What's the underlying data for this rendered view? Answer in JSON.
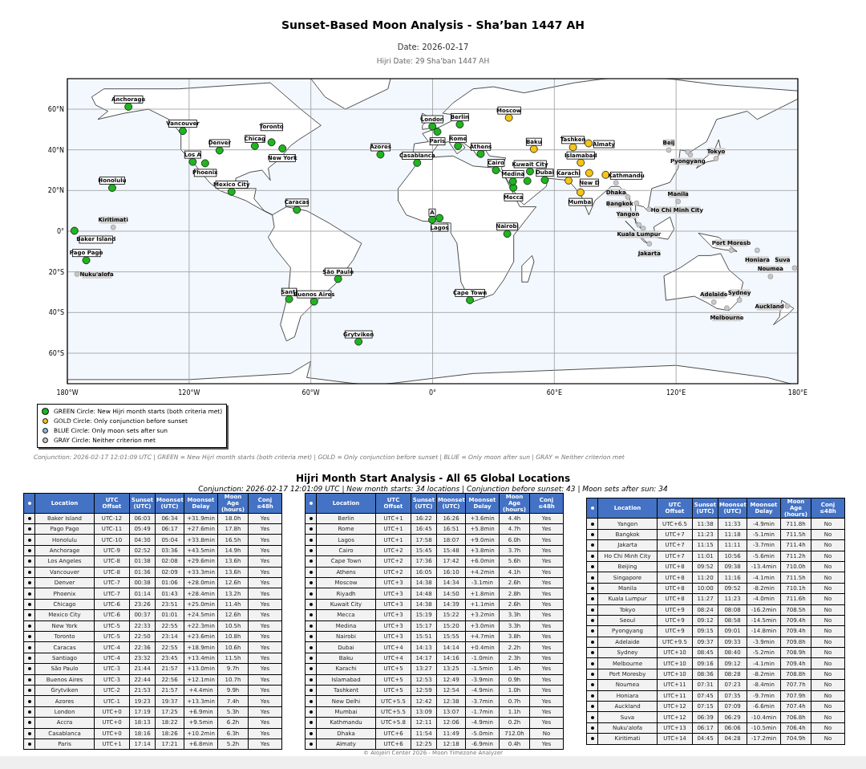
{
  "title": "Sunset-Based Moon Analysis - Sha’ban 1447 AH",
  "date": "Date: 2026-02-17",
  "hijri_date": "Hijri Date: 29 Sha'ban 1447 AH",
  "map": {
    "chart_data": {
      "type": "scatter",
      "grid": true,
      "xlim": [
        -180,
        180
      ],
      "ylim": [
        -75,
        75
      ],
      "xticks": [
        {
          "value": -180,
          "label": "180°W"
        },
        {
          "value": -120,
          "label": "120°W"
        },
        {
          "value": -60,
          "label": "60°W"
        },
        {
          "value": 0,
          "label": "0°"
        },
        {
          "value": 60,
          "label": "60°E"
        },
        {
          "value": 120,
          "label": "120°E"
        },
        {
          "value": 180,
          "label": "180°E"
        }
      ],
      "yticks": [
        {
          "value": 60,
          "label": "60°N"
        },
        {
          "value": 40,
          "label": "40°N"
        },
        {
          "value": 20,
          "label": "20°N"
        },
        {
          "value": 0,
          "label": "0°"
        },
        {
          "value": -20,
          "label": "20°S"
        },
        {
          "value": -40,
          "label": "40°S"
        },
        {
          "value": -60,
          "label": "60°S"
        }
      ],
      "series": [
        {
          "name": "GREEN Circle: New Hijri month starts (both criteria met)",
          "color": "#1fb51f",
          "x": [
            -176.5,
            -170.7,
            -157.9,
            -149.9,
            -118.2,
            -123.1,
            -105,
            -112.1,
            -87.6,
            -99.1,
            -74,
            -79.4,
            -66.9,
            -70.7,
            -46.6,
            -58.4,
            -36.5,
            -25.7,
            -0.1,
            -0.2,
            -7.6,
            2.35,
            13.4,
            12.5,
            3.4,
            31.2,
            18.4,
            23.7,
            46.7,
            48,
            39.8,
            39.6,
            36.8,
            55.3
          ],
          "values": [
            0.2,
            -14.3,
            21.3,
            61.2,
            34.1,
            49.3,
            39.7,
            33.4,
            41.9,
            19.4,
            40.7,
            43.7,
            10.5,
            -33.4,
            -23.5,
            -34.6,
            -54.3,
            37.7,
            51.5,
            5.6,
            33.6,
            48.9,
            52.5,
            41.9,
            6.5,
            30,
            -33.9,
            38,
            24.7,
            29.4,
            21.4,
            24.5,
            -1.3,
            25.2
          ]
        },
        {
          "name": "GOLD Circle: Only conjunction before sunset",
          "color": "#f5c518",
          "x": [
            37.6,
            49.9,
            67,
            73,
            69.2,
            77.2,
            72.9,
            85.3,
            76.9
          ],
          "values": [
            55.8,
            40.4,
            24.9,
            33.7,
            41.3,
            28.6,
            19.1,
            27.7,
            43.2
          ]
        },
        {
          "name": "BLUE Circle: Only moon sets after sun",
          "color": "#8fbbd9"
        },
        {
          "name": "GRAY Circle: Neither criterion met",
          "color": "#c8c8c8",
          "x": [
            90.4,
            96.2,
            100.5,
            106.8,
            106.7,
            116.4,
            103.8,
            121,
            101.7,
            139.7,
            127,
            125.8,
            138.6,
            151.2,
            145,
            147.2,
            166.5,
            160,
            174.8,
            178.4,
            -175.2,
            -157.4
          ],
          "values": [
            23.8,
            16.8,
            13.8,
            -6.2,
            10.8,
            39.9,
            1.4,
            14.6,
            3.1,
            35.7,
            37.6,
            39,
            -34.9,
            -33.9,
            -37.8,
            -9.4,
            -22.3,
            -9.4,
            -36.8,
            -18.1,
            -21.1,
            1.9
          ]
        }
      ],
      "annotations": [
        {
          "text": "Baker Island",
          "x": -176.5,
          "y": 0.2
        },
        {
          "text": "Pago Pago",
          "x": -170.7,
          "y": -14.3
        },
        {
          "text": "Honolulu",
          "x": -157.9,
          "y": 21.3
        },
        {
          "text": "Anchorage",
          "x": -149.9,
          "y": 61.2
        },
        {
          "text": "Los A",
          "x": -118.2,
          "y": 34.1
        },
        {
          "text": "Vancouver",
          "x": -123.1,
          "y": 49.3
        },
        {
          "text": "Denver",
          "x": -105,
          "y": 39.7
        },
        {
          "text": "Phoenix",
          "x": -112.1,
          "y": 33.4
        },
        {
          "text": "Chicag",
          "x": -87.6,
          "y": 41.9
        },
        {
          "text": "Mexico City",
          "x": -99.1,
          "y": 19.4
        },
        {
          "text": "New York",
          "x": -74,
          "y": 40.7
        },
        {
          "text": "Toronto",
          "x": -79.4,
          "y": 43.7
        },
        {
          "text": "Caracas",
          "x": -66.9,
          "y": 10.5
        },
        {
          "text": "Santi",
          "x": -70.7,
          "y": -33.4
        },
        {
          "text": "São Paulo",
          "x": -46.6,
          "y": -23.5
        },
        {
          "text": "Buenos Aires",
          "x": -58.4,
          "y": -34.6
        },
        {
          "text": "Grytviken",
          "x": -36.5,
          "y": -54.3
        },
        {
          "text": "Azores",
          "x": -25.7,
          "y": 37.7
        },
        {
          "text": "London",
          "x": -0.1,
          "y": 51.5
        },
        {
          "text": "A",
          "x": -0.2,
          "y": 5.6
        },
        {
          "text": "Casablanca",
          "x": -7.6,
          "y": 33.6
        },
        {
          "text": "Paris",
          "x": 2.35,
          "y": 48.9
        },
        {
          "text": "Berlin",
          "x": 13.4,
          "y": 52.5
        },
        {
          "text": "Rome",
          "x": 12.5,
          "y": 41.9
        },
        {
          "text": "Lagos",
          "x": 3.4,
          "y": 6.5
        },
        {
          "text": "Cairo",
          "x": 31.2,
          "y": 30
        },
        {
          "text": "Cape Town",
          "x": 18.4,
          "y": -33.9
        },
        {
          "text": "Athens",
          "x": 23.7,
          "y": 38
        },
        {
          "text": "Kuwait City",
          "x": 48,
          "y": 29.4
        },
        {
          "text": "Mecca",
          "x": 39.8,
          "y": 21.4
        },
        {
          "text": "Medina",
          "x": 39.6,
          "y": 24.5
        },
        {
          "text": "Nairobi",
          "x": 36.8,
          "y": -1.3
        },
        {
          "text": "Dubai",
          "x": 55.3,
          "y": 25.2
        },
        {
          "text": "Moscow",
          "x": 37.6,
          "y": 55.8
        },
        {
          "text": "Baku",
          "x": 49.9,
          "y": 40.4
        },
        {
          "text": "Karachi",
          "x": 67,
          "y": 24.9
        },
        {
          "text": "Islamabad",
          "x": 73,
          "y": 33.7
        },
        {
          "text": "Tashken",
          "x": 69.2,
          "y": 41.3
        },
        {
          "text": "Almaty",
          "x": 76.9,
          "y": 43.2
        },
        {
          "text": "New D",
          "x": 77.2,
          "y": 28.6
        },
        {
          "text": "Kathmandu",
          "x": 85.3,
          "y": 27.7
        },
        {
          "text": "Mumbai",
          "x": 72.9,
          "y": 19.1
        },
        {
          "text": "Dhaka",
          "x": 90.4,
          "y": 23.8
        },
        {
          "text": "Yangon",
          "x": 96.2,
          "y": 16.8
        },
        {
          "text": "Bangkok",
          "x": 100.5,
          "y": 13.8
        },
        {
          "text": "Ho Chi Minh City",
          "x": 106.7,
          "y": 10.8
        },
        {
          "text": "Beij",
          "x": 116.4,
          "y": 39.9
        },
        {
          "text": "Pyongyang",
          "x": 125.8,
          "y": 39
        },
        {
          "text": "Tokyo",
          "x": 139.7,
          "y": 35.7
        },
        {
          "text": "Manila",
          "x": 121,
          "y": 14.6
        },
        {
          "text": "Kuala Lumpur",
          "x": 101.7,
          "y": 3.1
        },
        {
          "text": "Jakarta",
          "x": 106.8,
          "y": -6.2
        },
        {
          "text": "Port Moresb",
          "x": 147.2,
          "y": -9.4
        },
        {
          "text": "Honiara",
          "x": 160,
          "y": -9.4
        },
        {
          "text": "Noumea",
          "x": 166.5,
          "y": -22.3
        },
        {
          "text": "Suva",
          "x": 178.4,
          "y": -18.1
        },
        {
          "text": "Adelaide",
          "x": 138.6,
          "y": -34.9
        },
        {
          "text": "Sydney",
          "x": 151.2,
          "y": -33.9
        },
        {
          "text": "Melbourne",
          "x": 145,
          "y": -37.8
        },
        {
          "text": "Auckland",
          "x": 174.8,
          "y": -36.8
        },
        {
          "text": "Nuku'alofa",
          "x": -175.2,
          "y": -21.1
        },
        {
          "text": "Kiritimati",
          "x": -157.4,
          "y": 1.9
        }
      ]
    }
  },
  "caption": "Conjunction: 2026-02-17 12:01:09 UTC | GREEN = New Hijri month starts (both criteria met) | GOLD = Only conjunction before sunset | BLUE = Only moon after sun | GRAY = Neither criterion met",
  "table_title": "Hijri Month Start Analysis - All 65 Global Locations",
  "table_subtitle": "Conjunction: 2026-02-17 12:01:09 UTC | New month starts: 34 locations | Conjunction before sunset: 43 | Moon sets after sun: 34",
  "tables": [
    {
      "columns": [
        "Location",
        "UTC Offset",
        "Sunset (UTC)",
        "Moonset (UTC)",
        "Moonset Delay",
        "Moon Age (hours)",
        "Conj ≤48h"
      ],
      "rows": [
        [
          "Baker Island",
          "UTC-12",
          "06:03",
          "06:34",
          "+31.9min",
          "18.0h",
          "Yes"
        ],
        [
          "Pago Pago",
          "UTC-11",
          "05:49",
          "06:17",
          "+27.6min",
          "17.8h",
          "Yes"
        ],
        [
          "Honolulu",
          "UTC-10",
          "04:30",
          "05:04",
          "+33.8min",
          "16.5h",
          "Yes"
        ],
        [
          "Anchorage",
          "UTC-9",
          "02:52",
          "03:36",
          "+43.5min",
          "14.9h",
          "Yes"
        ],
        [
          "Los Angeles",
          "UTC-8",
          "01:38",
          "02:08",
          "+29.6min",
          "13.6h",
          "Yes"
        ],
        [
          "Vancouver",
          "UTC-8",
          "01:36",
          "02:09",
          "+33.3min",
          "13.6h",
          "Yes"
        ],
        [
          "Denver",
          "UTC-7",
          "00:38",
          "01:06",
          "+28.0min",
          "12.6h",
          "Yes"
        ],
        [
          "Phoenix",
          "UTC-7",
          "01:14",
          "01:43",
          "+28.4min",
          "13.2h",
          "Yes"
        ],
        [
          "Chicago",
          "UTC-6",
          "23:26",
          "23:51",
          "+25.0min",
          "11.4h",
          "Yes"
        ],
        [
          "Mexico City",
          "UTC-6",
          "00:37",
          "01:01",
          "+24.5min",
          "12.6h",
          "Yes"
        ],
        [
          "New York",
          "UTC-5",
          "22:33",
          "22:55",
          "+22.3min",
          "10.5h",
          "Yes"
        ],
        [
          "Toronto",
          "UTC-5",
          "22:50",
          "23:14",
          "+23.6min",
          "10.8h",
          "Yes"
        ],
        [
          "Caracas",
          "UTC-4",
          "22:36",
          "22:55",
          "+18.9min",
          "10.6h",
          "Yes"
        ],
        [
          "Santiago",
          "UTC-4",
          "23:32",
          "23:45",
          "+13.4min",
          "11.5h",
          "Yes"
        ],
        [
          "São Paulo",
          "UTC-3",
          "21:44",
          "21:57",
          "+13.0min",
          "9.7h",
          "Yes"
        ],
        [
          "Buenos Aires",
          "UTC-3",
          "22:44",
          "22:56",
          "+12.1min",
          "10.7h",
          "Yes"
        ],
        [
          "Grytviken",
          "UTC-2",
          "21:53",
          "21:57",
          "+4.4min",
          "9.9h",
          "Yes"
        ],
        [
          "Azores",
          "UTC-1",
          "19:23",
          "19:37",
          "+13.3min",
          "7.4h",
          "Yes"
        ],
        [
          "London",
          "UTC+0",
          "17:19",
          "17:25",
          "+6.9min",
          "5.3h",
          "Yes"
        ],
        [
          "Accra",
          "UTC+0",
          "18:13",
          "18:22",
          "+9.5min",
          "6.2h",
          "Yes"
        ],
        [
          "Casablanca",
          "UTC+0",
          "18:16",
          "18:26",
          "+10.2min",
          "6.3h",
          "Yes"
        ],
        [
          "Paris",
          "UTC+1",
          "17:14",
          "17:21",
          "+6.8min",
          "5.2h",
          "Yes"
        ]
      ]
    },
    {
      "columns": [
        "Location",
        "UTC Offset",
        "Sunset (UTC)",
        "Moonset (UTC)",
        "Moonset Delay",
        "Moon Age (hours)",
        "Conj ≤48h"
      ],
      "rows": [
        [
          "Berlin",
          "UTC+1",
          "16:22",
          "16:26",
          "+3.6min",
          "4.4h",
          "Yes"
        ],
        [
          "Rome",
          "UTC+1",
          "16:45",
          "16:51",
          "+5.8min",
          "4.7h",
          "Yes"
        ],
        [
          "Lagos",
          "UTC+1",
          "17:58",
          "18:07",
          "+9.0min",
          "6.0h",
          "Yes"
        ],
        [
          "Cairo",
          "UTC+2",
          "15:45",
          "15:48",
          "+3.8min",
          "3.7h",
          "Yes"
        ],
        [
          "Cape Town",
          "UTC+2",
          "17:36",
          "17:42",
          "+6.0min",
          "5.6h",
          "Yes"
        ],
        [
          "Athens",
          "UTC+2",
          "16:05",
          "16:10",
          "+4.2min",
          "4.1h",
          "Yes"
        ],
        [
          "Moscow",
          "UTC+3",
          "14:38",
          "14:34",
          "-3.1min",
          "2.6h",
          "Yes"
        ],
        [
          "Riyadh",
          "UTC+3",
          "14:48",
          "14:50",
          "+1.8min",
          "2.8h",
          "Yes"
        ],
        [
          "Kuwait City",
          "UTC+3",
          "14:38",
          "14:39",
          "+1.1min",
          "2.6h",
          "Yes"
        ],
        [
          "Mecca",
          "UTC+3",
          "15:19",
          "15:22",
          "+3.2min",
          "3.3h",
          "Yes"
        ],
        [
          "Medina",
          "UTC+3",
          "15:17",
          "15:20",
          "+3.0min",
          "3.3h",
          "Yes"
        ],
        [
          "Nairobi",
          "UTC+3",
          "15:51",
          "15:55",
          "+4.7min",
          "3.8h",
          "Yes"
        ],
        [
          "Dubai",
          "UTC+4",
          "14:13",
          "14:14",
          "+0.4min",
          "2.2h",
          "Yes"
        ],
        [
          "Baku",
          "UTC+4",
          "14:17",
          "14:16",
          "-1.0min",
          "2.3h",
          "Yes"
        ],
        [
          "Karachi",
          "UTC+5",
          "13:27",
          "13:25",
          "-1.5min",
          "1.4h",
          "Yes"
        ],
        [
          "Islamabad",
          "UTC+5",
          "12:53",
          "12:49",
          "-3.9min",
          "0.9h",
          "Yes"
        ],
        [
          "Tashkent",
          "UTC+5",
          "12:59",
          "12:54",
          "-4.9min",
          "1.0h",
          "Yes"
        ],
        [
          "New Delhi",
          "UTC+5.5",
          "12:42",
          "12:38",
          "-3.7min",
          "0.7h",
          "Yes"
        ],
        [
          "Mumbai",
          "UTC+5.5",
          "13:09",
          "13:07",
          "-1.7min",
          "1.1h",
          "Yes"
        ],
        [
          "Kathmandu",
          "UTC+5.8",
          "12:11",
          "12:06",
          "-4.9min",
          "0.2h",
          "Yes"
        ],
        [
          "Dhaka",
          "UTC+6",
          "11:54",
          "11:49",
          "-5.0min",
          "712.0h",
          "No"
        ],
        [
          "Almaty",
          "UTC+6",
          "12:25",
          "12:18",
          "-6.9min",
          "0.4h",
          "Yes"
        ]
      ]
    },
    {
      "columns": [
        "Location",
        "UTC Offset",
        "Sunset (UTC)",
        "Moonset (UTC)",
        "Moonset Delay",
        "Moon Age (hours)",
        "Conj ≤48h"
      ],
      "rows": [
        [
          "Yangon",
          "UTC+6.5",
          "11:38",
          "11:33",
          "-4.9min",
          "711.8h",
          "No"
        ],
        [
          "Bangkok",
          "UTC+7",
          "11:23",
          "11:18",
          "-5.1min",
          "711.5h",
          "No"
        ],
        [
          "Jakarta",
          "UTC+7",
          "11:15",
          "11:11",
          "-3.7min",
          "711.4h",
          "No"
        ],
        [
          "Ho Chi Minh City",
          "UTC+7",
          "11:01",
          "10:56",
          "-5.6min",
          "711.2h",
          "No"
        ],
        [
          "Beijing",
          "UTC+8",
          "09:52",
          "09:38",
          "-13.4min",
          "710.0h",
          "No"
        ],
        [
          "Singapore",
          "UTC+8",
          "11:20",
          "11:16",
          "-4.1min",
          "711.5h",
          "No"
        ],
        [
          "Manila",
          "UTC+8",
          "10:00",
          "09:52",
          "-8.2min",
          "710.1h",
          "No"
        ],
        [
          "Kuala Lumpur",
          "UTC+8",
          "11:27",
          "11:23",
          "-4.0min",
          "711.6h",
          "No"
        ],
        [
          "Tokyo",
          "UTC+9",
          "08:24",
          "08:08",
          "-16.2min",
          "708.5h",
          "No"
        ],
        [
          "Seoul",
          "UTC+9",
          "09:12",
          "08:58",
          "-14.5min",
          "709.4h",
          "No"
        ],
        [
          "Pyongyang",
          "UTC+9",
          "09:15",
          "09:01",
          "-14.8min",
          "709.4h",
          "No"
        ],
        [
          "Adelaide",
          "UTC+9.5",
          "09:37",
          "09:33",
          "-3.9min",
          "709.8h",
          "No"
        ],
        [
          "Sydney",
          "UTC+10",
          "08:45",
          "08:40",
          "-5.2min",
          "708.9h",
          "No"
        ],
        [
          "Melbourne",
          "UTC+10",
          "09:16",
          "09:12",
          "-4.1min",
          "709.4h",
          "No"
        ],
        [
          "Port Moresby",
          "UTC+10",
          "08:36",
          "08:28",
          "-8.2min",
          "708.8h",
          "No"
        ],
        [
          "Noumea",
          "UTC+11",
          "07:31",
          "07:23",
          "-8.4min",
          "707.7h",
          "No"
        ],
        [
          "Honiara",
          "UTC+11",
          "07:45",
          "07:35",
          "-9.7min",
          "707.9h",
          "No"
        ],
        [
          "Auckland",
          "UTC+12",
          "07:15",
          "07:09",
          "-6.6min",
          "707.4h",
          "No"
        ],
        [
          "Suva",
          "UTC+12",
          "06:39",
          "06:29",
          "-10.4min",
          "706.8h",
          "No"
        ],
        [
          "Nuku'alofa",
          "UTC+13",
          "06:17",
          "06:06",
          "-10.5min",
          "706.4h",
          "No"
        ],
        [
          "Kiritimati",
          "UTC+14",
          "04:45",
          "04:28",
          "-17.2min",
          "704.9h",
          "No"
        ]
      ]
    }
  ],
  "footer": "© Alojeiri Center 2026 - Moon Timezone Analyzer"
}
